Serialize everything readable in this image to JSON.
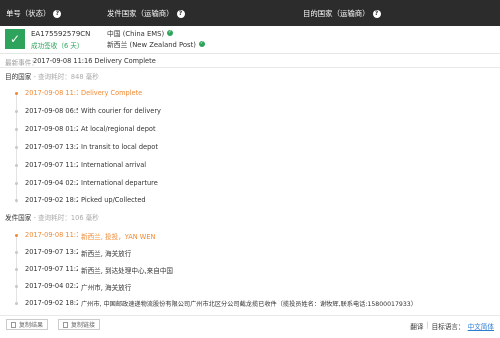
{
  "header": {
    "col1_label": "单号（状态）",
    "col2_label": "发件国家（运输商）",
    "col3_label": "目的国家（运输商）"
  },
  "summary": {
    "tracking_number": "EA175592579CN",
    "status": "成功签收（6 天）",
    "origin_carrier": "中国 (China EMS)",
    "dest_carrier": "新西兰 (New Zealand Post)"
  },
  "latest": {
    "label": "最新事件：",
    "value": "2017-09-08 11:16 Delivery Complete"
  },
  "destination_section": {
    "title": "目的国家",
    "subtitle": "- 查询耗时：848 毫秒",
    "events": [
      {
        "time": "2017-09-08 11:16",
        "desc": "Delivery Complete"
      },
      {
        "time": "2017-09-08 06:56",
        "desc": "With courier for delivery"
      },
      {
        "time": "2017-09-08 01:20",
        "desc": "At local/regional depot"
      },
      {
        "time": "2017-09-07 13:20",
        "desc": "In transit to local depot"
      },
      {
        "time": "2017-09-07 11:20",
        "desc": "International arrival"
      },
      {
        "time": "2017-09-04 02:20",
        "desc": "International departure"
      },
      {
        "time": "2017-09-02 18:20",
        "desc": "Picked up/Collected"
      }
    ]
  },
  "origin_section": {
    "title": "发件国家",
    "subtitle": "- 查询耗时：106 毫秒",
    "events": [
      {
        "time": "2017-09-08 11:16",
        "desc": "新西兰, 投投，YAN WEN"
      },
      {
        "time": "2017-09-07 13:20",
        "desc": "新西兰, 海关放行"
      },
      {
        "time": "2017-09-07 11:20",
        "desc": "新西兰, 到达处理中心,来自中国"
      },
      {
        "time": "2017-09-04 02:20",
        "desc": "广州市, 海关放行"
      },
      {
        "time": "2017-09-02 18:20",
        "desc": "广州市, 中国邮政速递物流股份有限公司广州市北区分公司截龙揽已收件（揽投员姓名：谢牧辉,联系电话:15800017933）"
      }
    ]
  },
  "footer": {
    "copy_result": "复制结果",
    "copy_link": "复制链接",
    "translate": "翻译",
    "sep": "|",
    "target_lang_label": "目标语言：",
    "target_lang_value": "中文简体"
  }
}
